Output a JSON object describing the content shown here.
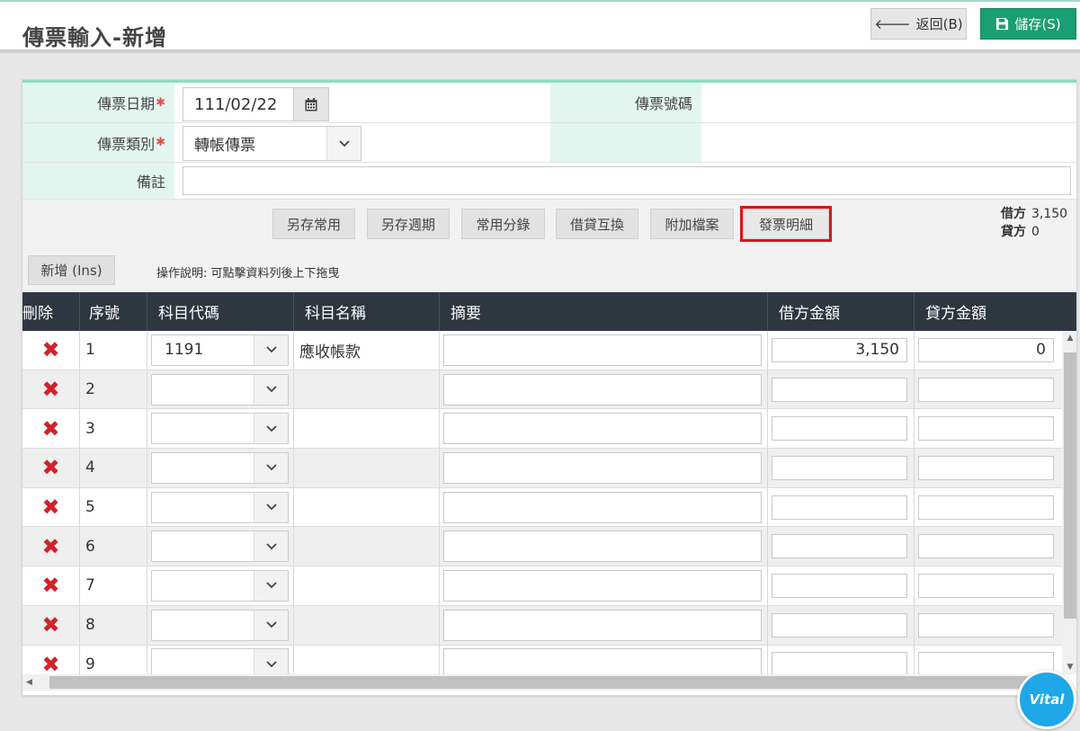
{
  "header": {
    "title": "傳票輸入-新增",
    "back_label": "返回(B)",
    "save_label": "儲存(S)"
  },
  "form": {
    "date_label": "傳票日期",
    "date_value": "111/02/22",
    "number_label": "傳票號碼",
    "number_value": "",
    "type_label": "傳票類別",
    "type_value": "轉帳傳票",
    "note_label": "備註",
    "note_value": "",
    "required_mark": "✱"
  },
  "toolbar": {
    "buttons": [
      "另存常用",
      "另存週期",
      "常用分錄",
      "借貸互換",
      "附加檔案",
      "發票明細"
    ],
    "debit_label": "借方",
    "debit_total": "3,150",
    "credit_label": "貸方",
    "credit_total": "0",
    "add_label": "新增 (Ins)",
    "help_text": "操作說明: 可點擊資料列後上下拖曳"
  },
  "grid": {
    "columns": [
      "刪除",
      "序號",
      "科目代碼",
      "科目名稱",
      "摘要",
      "借方金額",
      "貸方金額"
    ],
    "rows": [
      {
        "seq": "1",
        "code": "1191",
        "name": "應收帳款",
        "memo": "",
        "debit": "3,150",
        "credit": "0"
      },
      {
        "seq": "2",
        "code": "",
        "name": "",
        "memo": "",
        "debit": "",
        "credit": ""
      },
      {
        "seq": "3",
        "code": "",
        "name": "",
        "memo": "",
        "debit": "",
        "credit": ""
      },
      {
        "seq": "4",
        "code": "",
        "name": "",
        "memo": "",
        "debit": "",
        "credit": ""
      },
      {
        "seq": "5",
        "code": "",
        "name": "",
        "memo": "",
        "debit": "",
        "credit": ""
      },
      {
        "seq": "6",
        "code": "",
        "name": "",
        "memo": "",
        "debit": "",
        "credit": ""
      },
      {
        "seq": "7",
        "code": "",
        "name": "",
        "memo": "",
        "debit": "",
        "credit": ""
      },
      {
        "seq": "8",
        "code": "",
        "name": "",
        "memo": "",
        "debit": "",
        "credit": ""
      },
      {
        "seq": "9",
        "code": "",
        "name": "",
        "memo": "",
        "debit": "",
        "credit": ""
      }
    ]
  },
  "brand": {
    "badge_text": "Vital"
  },
  "colors": {
    "accent": "#1a9e73",
    "header_bar": "#2e3641",
    "label_bg": "#e2f6ef",
    "highlight": "#e0141a",
    "delete": "#d0232b"
  }
}
